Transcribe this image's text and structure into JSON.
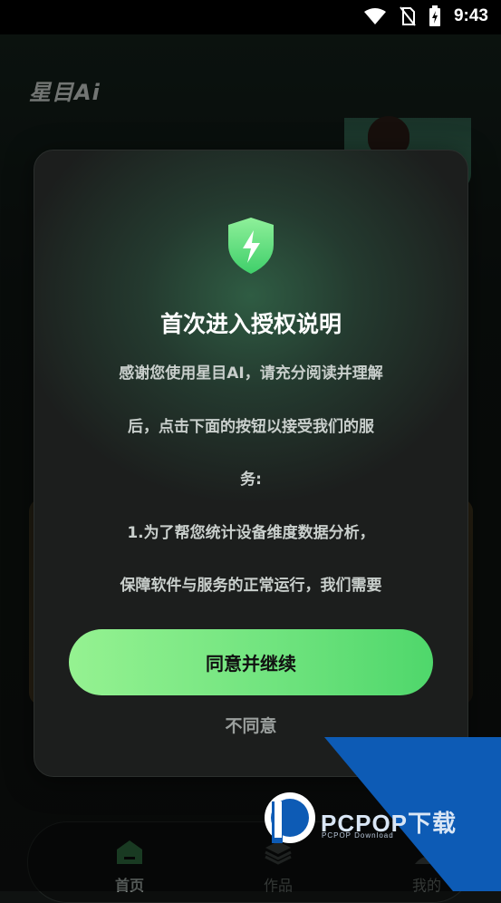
{
  "status_bar": {
    "time": "9:43"
  },
  "app": {
    "logo_text": "星目Ai"
  },
  "dialog": {
    "title": "首次进入授权说明",
    "body_lines": [
      "感谢您使用星目AI，请充分阅读并理解",
      "后，点击下面的按钮以接受我们的服",
      "务:",
      "1.为了帮您统计设备维度数据分析，",
      "保障软件与服务的正常运行，我们需要"
    ],
    "agree_label": "同意并继续",
    "disagree_label": "不同意"
  },
  "bottom_nav": [
    {
      "label": "首页",
      "icon": "home-icon",
      "active": true
    },
    {
      "label": "作品",
      "icon": "layers-icon",
      "active": false
    },
    {
      "label": "我的",
      "icon": "profile-icon",
      "active": false
    }
  ],
  "watermark": {
    "text": "PCPOP下载",
    "sub": "PCPOP Download"
  },
  "colors": {
    "accent_green": "#71e47f",
    "dialog_bg": "#1c1e1d",
    "watermark_blue": "#0d5bb5"
  }
}
